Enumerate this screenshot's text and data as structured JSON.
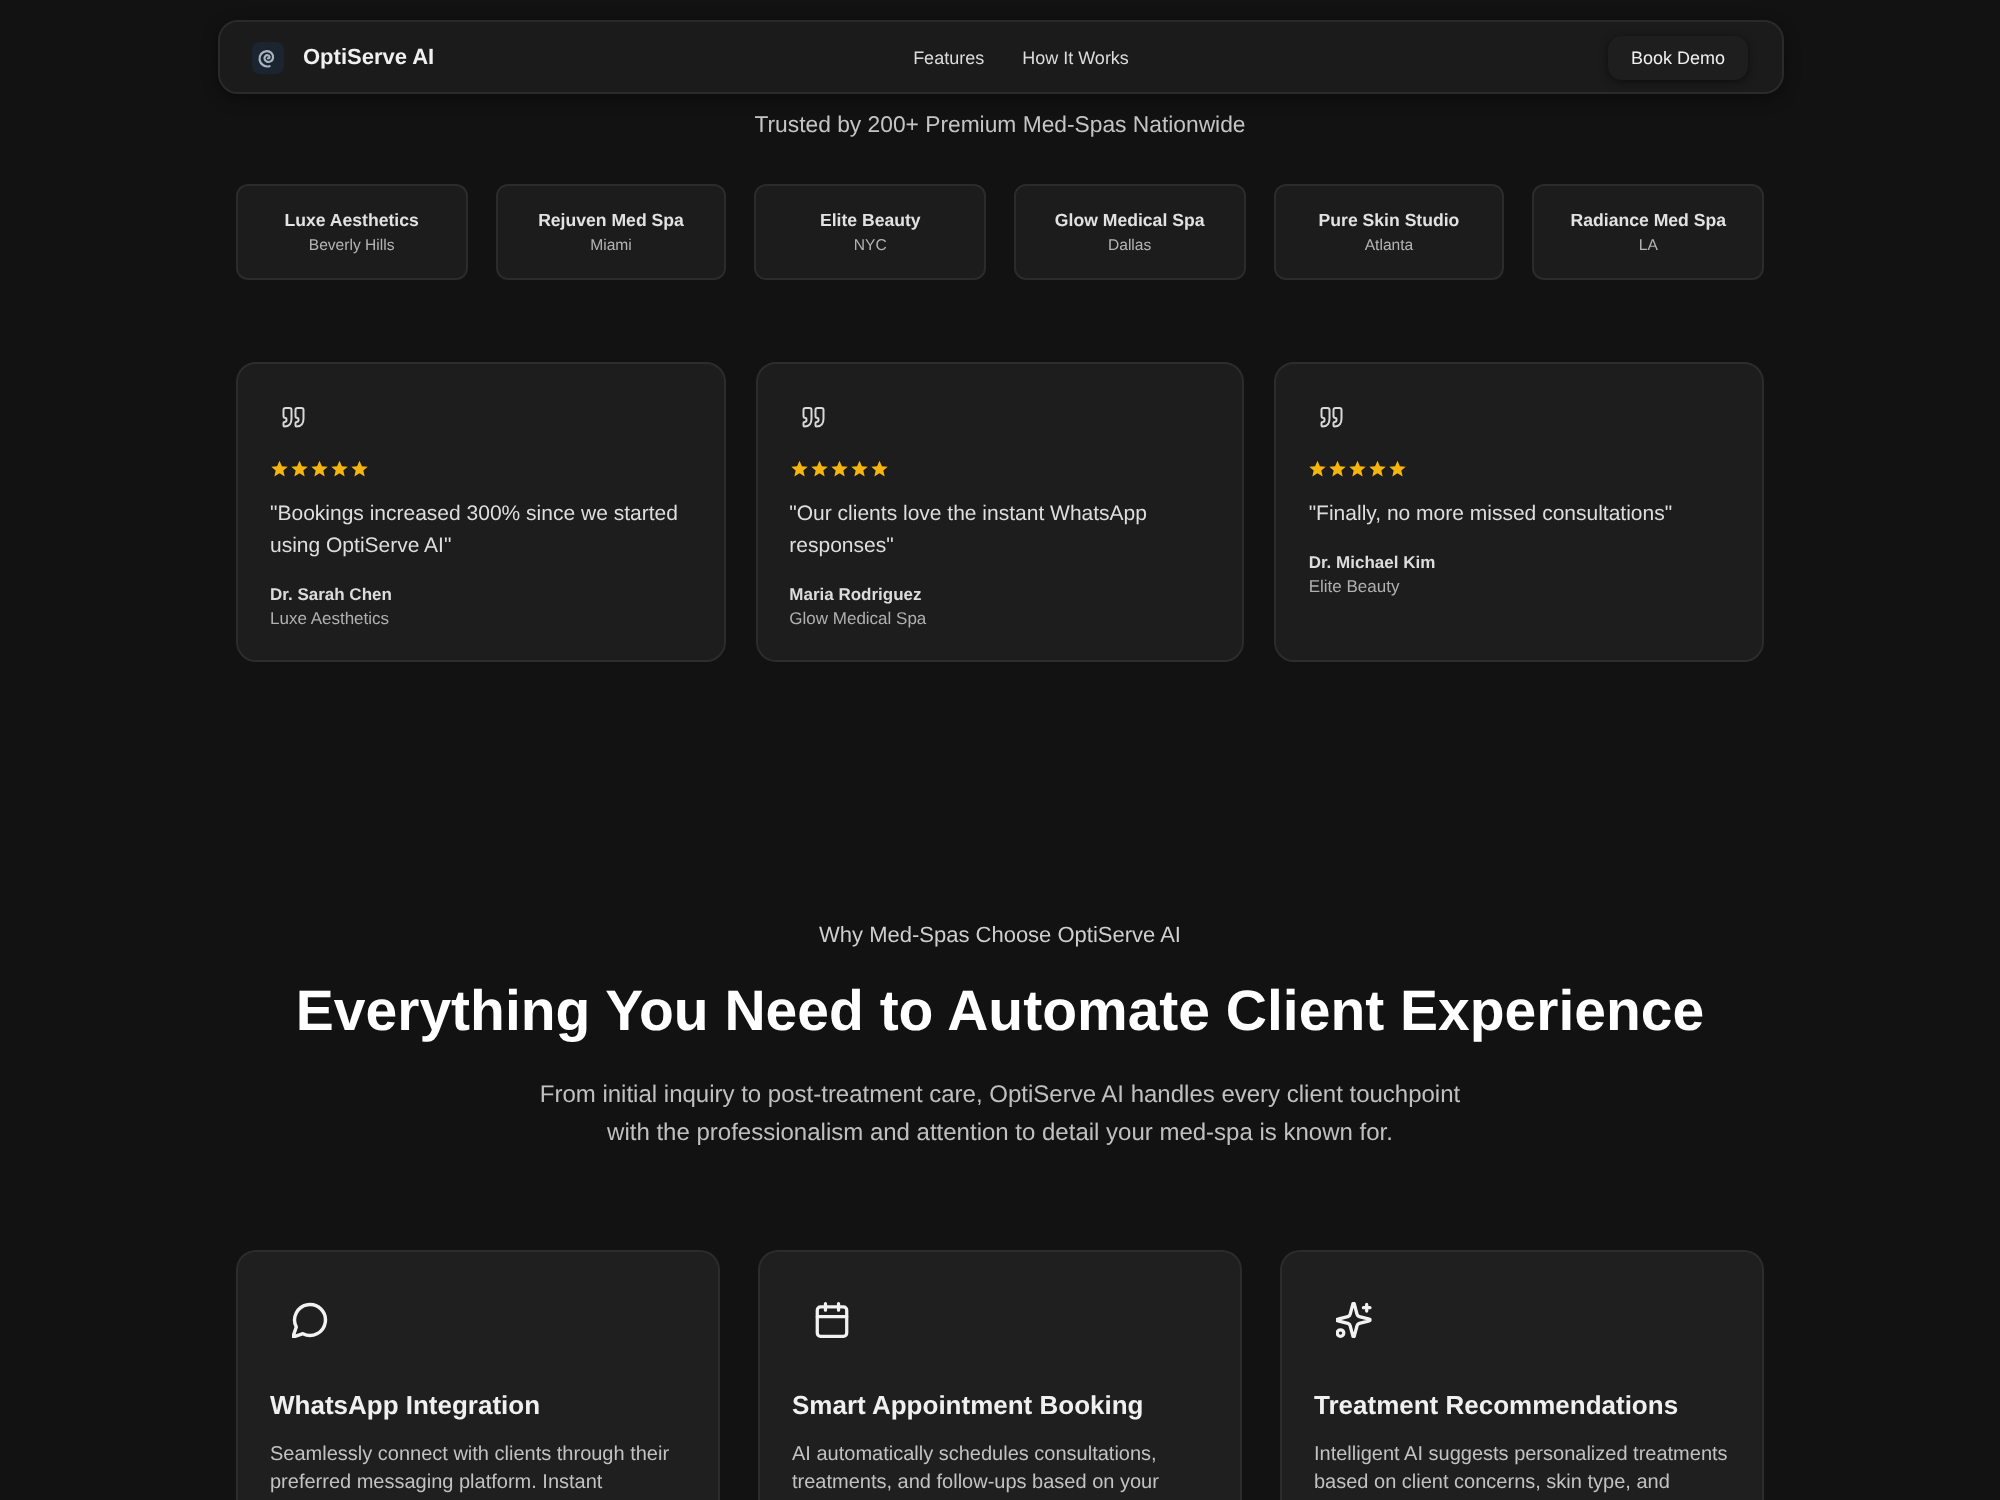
{
  "nav": {
    "brand": "OptiServe AI",
    "links": [
      "Features",
      "How It Works"
    ],
    "cta": "Book Demo"
  },
  "trusted": {
    "title": "Trusted by 200+ Premium Med-Spas Nationwide",
    "clients": [
      {
        "name": "Luxe Aesthetics",
        "city": "Beverly Hills"
      },
      {
        "name": "Rejuven Med Spa",
        "city": "Miami"
      },
      {
        "name": "Elite Beauty",
        "city": "NYC"
      },
      {
        "name": "Glow Medical Spa",
        "city": "Dallas"
      },
      {
        "name": "Pure Skin Studio",
        "city": "Atlanta"
      },
      {
        "name": "Radiance Med Spa",
        "city": "LA"
      }
    ]
  },
  "testimonials": [
    {
      "quote": "\"Bookings increased 300% since we started using OptiServe AI\"",
      "stars": 5,
      "name": "Dr. Sarah Chen",
      "company": "Luxe Aesthetics"
    },
    {
      "quote": "\"Our clients love the instant WhatsApp responses\"",
      "stars": 5,
      "name": "Maria Rodriguez",
      "company": "Glow Medical Spa"
    },
    {
      "quote": "\"Finally, no more missed consultations\"",
      "stars": 5,
      "name": "Dr. Michael Kim",
      "company": "Elite Beauty"
    }
  ],
  "features_section": {
    "eyebrow": "Why Med-Spas Choose OptiServe AI",
    "title": "Everything You Need to Automate Client Experience",
    "intro": "From initial inquiry to post-treatment care, OptiServe AI handles every client touchpoint with the professionalism and attention to detail your med-spa is known for.",
    "features": [
      {
        "title": "WhatsApp Integration",
        "description": "Seamlessly connect with clients through their preferred messaging platform. Instant"
      },
      {
        "title": "Smart Appointment Booking",
        "description": "AI automatically schedules consultations, treatments, and follow-ups based on your"
      },
      {
        "title": "Treatment Recommendations",
        "description": "Intelligent AI suggests personalized treatments based on client concerns, skin type, and"
      }
    ]
  }
}
